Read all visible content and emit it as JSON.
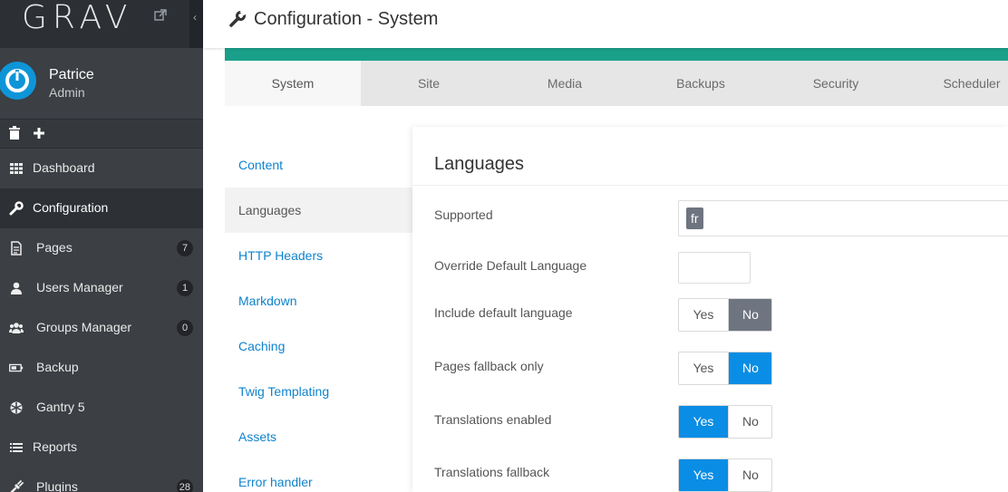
{
  "brand": {
    "logo": "GRAV"
  },
  "user": {
    "name": "Patrice",
    "role": "Admin"
  },
  "quick_actions": [
    "trash-icon",
    "plus-icon"
  ],
  "nav": [
    {
      "label": "Dashboard",
      "icon": "grid-icon",
      "badge": ""
    },
    {
      "label": "Configuration",
      "icon": "wrench-icon",
      "badge": "",
      "active": true
    },
    {
      "label": "Pages",
      "icon": "file-icon",
      "badge": "7"
    },
    {
      "label": "Users Manager",
      "icon": "user-icon",
      "badge": "1"
    },
    {
      "label": "Groups Manager",
      "icon": "users-icon",
      "badge": "0"
    },
    {
      "label": "Backup",
      "icon": "battery-icon",
      "badge": ""
    },
    {
      "label": "Gantry 5",
      "icon": "gantry-icon",
      "badge": ""
    },
    {
      "label": "Reports",
      "icon": "list-icon",
      "badge": ""
    },
    {
      "label": "Plugins",
      "icon": "plug-icon",
      "badge": "28"
    }
  ],
  "header": {
    "title": "Configuration - System"
  },
  "tabs": [
    "System",
    "Site",
    "Media",
    "Backups",
    "Security",
    "Scheduler"
  ],
  "active_tab": "System",
  "sections": [
    "Content",
    "Languages",
    "HTTP Headers",
    "Markdown",
    "Caching",
    "Twig Templating",
    "Assets",
    "Error handler"
  ],
  "active_section": "Languages",
  "panel": {
    "title": "Languages",
    "supported_label": "Supported",
    "supported_tags": [
      "fr"
    ],
    "override_label": "Override Default Language",
    "override_value": "",
    "toggles": [
      {
        "label": "Include default language",
        "yes": "Yes",
        "no": "No",
        "value": "No"
      },
      {
        "label": "Pages fallback only",
        "yes": "Yes",
        "no": "No",
        "value": "No"
      },
      {
        "label": "Translations enabled",
        "yes": "Yes",
        "no": "No",
        "value": "Yes"
      },
      {
        "label": "Translations fallback",
        "yes": "Yes",
        "no": "No",
        "value": "Yes"
      }
    ]
  },
  "colors": {
    "sidebar": "#3c3f44",
    "accent_blue": "#0a8de4",
    "teal": "#1aa08a",
    "link": "#0e83cd"
  }
}
